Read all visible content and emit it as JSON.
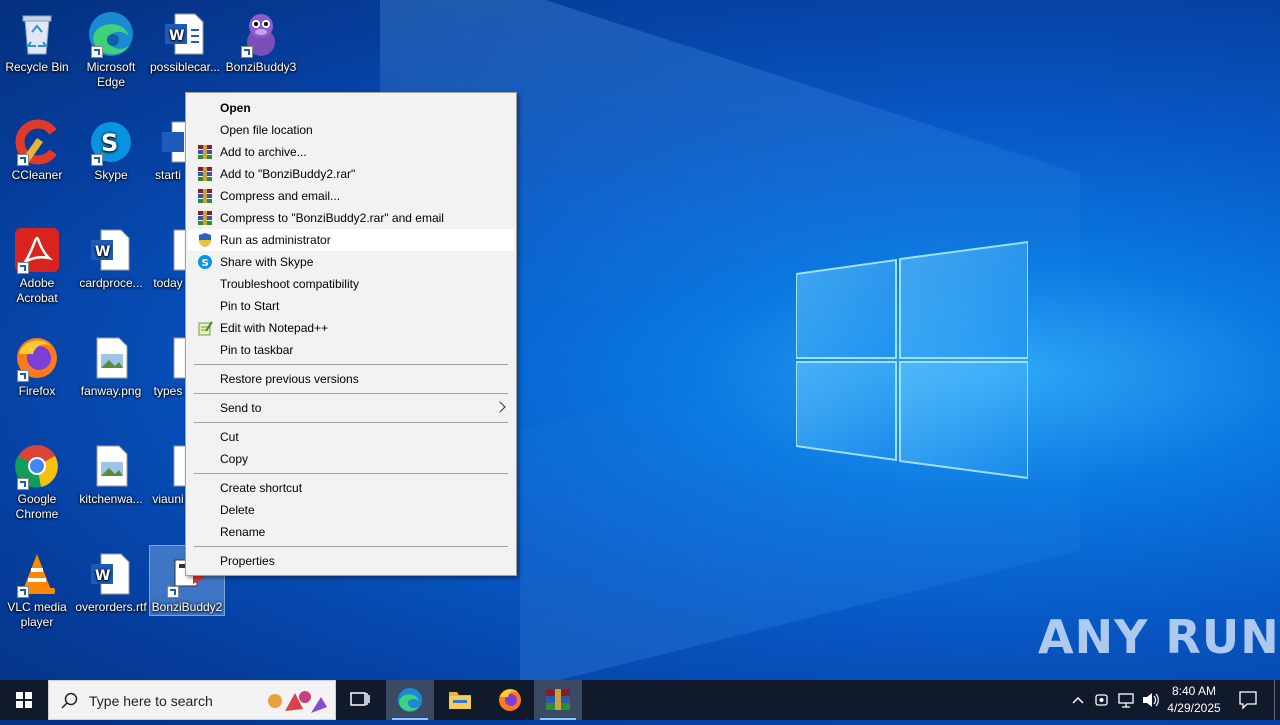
{
  "desktop_icons": [
    {
      "label": "Recycle Bin"
    },
    {
      "label": "Microsoft Edge"
    },
    {
      "label": "possiblecar..."
    },
    {
      "label": "BonziBuddy3"
    },
    {
      "label": "CCleaner"
    },
    {
      "label": "Skype"
    },
    {
      "label": "starti"
    },
    {
      "label": "Adobe Acrobat"
    },
    {
      "label": "cardproce..."
    },
    {
      "label": "today"
    },
    {
      "label": "Firefox"
    },
    {
      "label": "fanway.png"
    },
    {
      "label": "types"
    },
    {
      "label": "Google Chrome"
    },
    {
      "label": "kitchenwa..."
    },
    {
      "label": "viauni"
    },
    {
      "label": "VLC media player"
    },
    {
      "label": "overorders.rtf"
    },
    {
      "label": "BonziBuddy2"
    }
  ],
  "context_menu": {
    "items": [
      {
        "label": "Open",
        "icon": "none"
      },
      {
        "label": "Open file location",
        "icon": "none"
      },
      {
        "label": "Add to archive...",
        "icon": "winrar-icon"
      },
      {
        "label": "Add to \"BonziBuddy2.rar\"",
        "icon": "winrar-icon"
      },
      {
        "label": "Compress and email...",
        "icon": "winrar-icon"
      },
      {
        "label": "Compress to \"BonziBuddy2.rar\" and email",
        "icon": "winrar-icon"
      },
      {
        "label": "Run as administrator",
        "icon": "uac-shield-icon"
      },
      {
        "label": "Share with Skype",
        "icon": "skype-icon"
      },
      {
        "label": "Troubleshoot compatibility",
        "icon": "none"
      },
      {
        "label": "Pin to Start",
        "icon": "none"
      },
      {
        "label": "Edit with Notepad++",
        "icon": "notepadpp-icon"
      },
      {
        "label": "Pin to taskbar",
        "icon": "none"
      },
      {
        "label": "Restore previous versions",
        "icon": "none"
      },
      {
        "label": "Send to",
        "icon": "none"
      },
      {
        "label": "Cut",
        "icon": "none"
      },
      {
        "label": "Copy",
        "icon": "none"
      },
      {
        "label": "Create shortcut",
        "icon": "none"
      },
      {
        "label": "Delete",
        "icon": "none"
      },
      {
        "label": "Rename",
        "icon": "none"
      },
      {
        "label": "Properties",
        "icon": "none"
      }
    ],
    "highlighted": "Run as administrator"
  },
  "taskbar": {
    "search_placeholder": "Type here to search",
    "apps": [
      "task-view-icon",
      "edge-icon",
      "file-explorer-icon",
      "firefox-icon",
      "winrar-icon"
    ],
    "time": "8:40 AM",
    "date": "4/29/2025"
  },
  "watermark": "ANY RUN",
  "colors": {
    "menu_bg": "#f2f2f2",
    "taskbar_bg": "#101a2a",
    "desktop_blue": "#0757c4"
  }
}
